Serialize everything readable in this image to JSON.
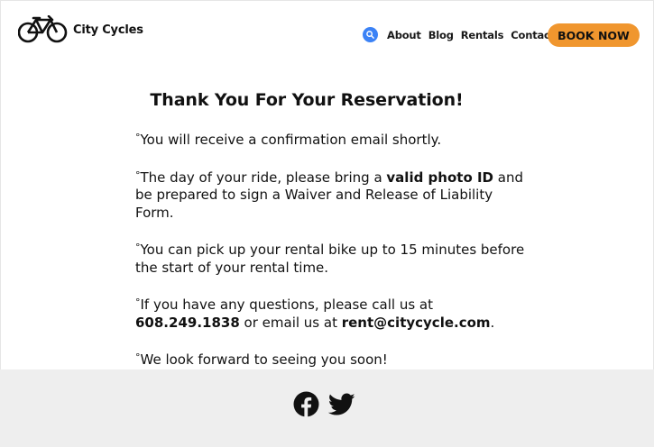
{
  "brand": {
    "name": "City Cycles",
    "logo_icon": "bicycle-icon"
  },
  "nav": {
    "search_icon": "search-icon",
    "links": [
      "About",
      "Blog",
      "Rentals",
      "Contact"
    ],
    "cta_label": "BOOK NOW"
  },
  "colors": {
    "accent": "#f0962e",
    "search": "#3b82f6",
    "footer_bg": "#eeeeee"
  },
  "page": {
    "title": "Thank You For Your Reservation!"
  },
  "notes": {
    "bullet": "°",
    "email": {
      "text": "You will receive a confirmation email shortly."
    },
    "id": {
      "before": "The day of your ride, please bring a ",
      "bold": "valid photo ID",
      "after": " and be prepared to sign a Waiver and Release of Liability Form."
    },
    "pickup": {
      "text": "You can pick up your rental bike up to 15 minutes before the start of your rental time."
    },
    "contact": {
      "before": "If you have any questions, please call us at ",
      "phone": "608.249.1838",
      "middle": " or email us at ",
      "email": "rent@citycycle.com",
      "after": "."
    },
    "closing": {
      "text": "We look forward to seeing you soon!"
    }
  },
  "footer": {
    "social": [
      "facebook-icon",
      "twitter-icon"
    ]
  }
}
